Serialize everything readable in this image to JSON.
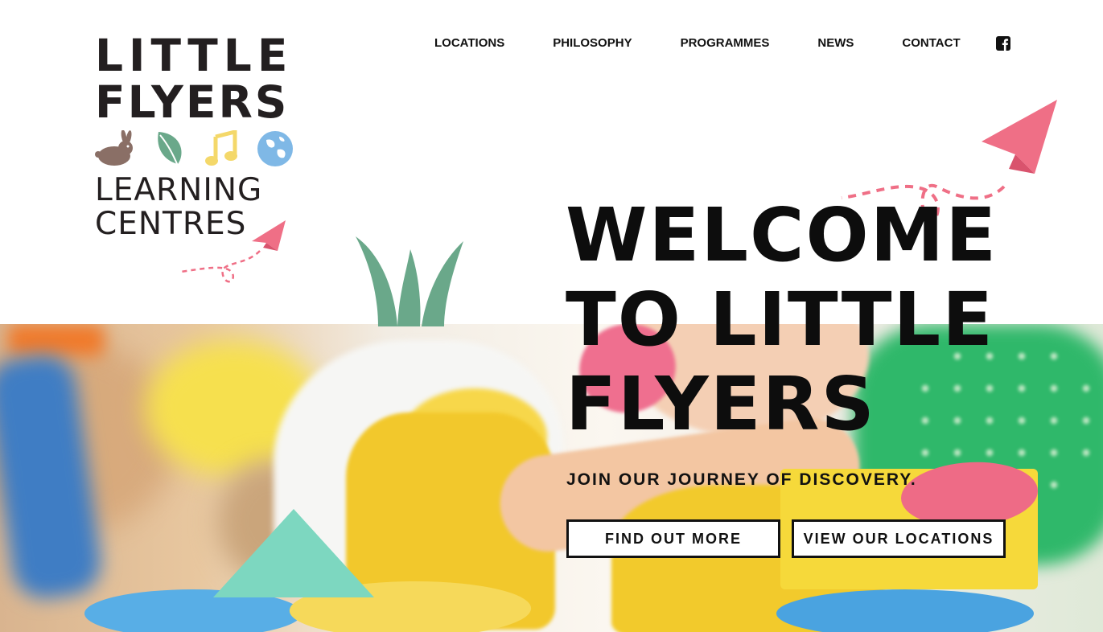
{
  "brand": {
    "line1": "LITTLE",
    "line2": "FLYERS",
    "line3": "LEARNING",
    "line4": "CENTRES",
    "icons": [
      "rabbit-icon",
      "leaf-icon",
      "music-note-icon",
      "globe-icon"
    ],
    "colors": {
      "rabbit": "#8a6f66",
      "leaf": "#6aa88a",
      "music": "#f4d86a",
      "globe": "#7fb8e6",
      "plane": "#ef6f86"
    }
  },
  "nav": {
    "items": [
      {
        "label": "LOCATIONS"
      },
      {
        "label": "PHILOSOPHY"
      },
      {
        "label": "PROGRAMMES"
      },
      {
        "label": "NEWS"
      },
      {
        "label": "CONTACT"
      }
    ],
    "social_icon": "facebook-icon"
  },
  "hero": {
    "title_line1": "WELCOME",
    "title_line2": "TO LITTLE",
    "title_line3": "FLYERS",
    "subtitle": "JOIN OUR JOURNEY OF DISCOVERY.",
    "primary_button": "FIND OUT MORE",
    "secondary_button": "VIEW OUR LOCATIONS"
  },
  "decor": {
    "grass_color": "#6aa88a",
    "plane_color": "#ef6f86"
  }
}
